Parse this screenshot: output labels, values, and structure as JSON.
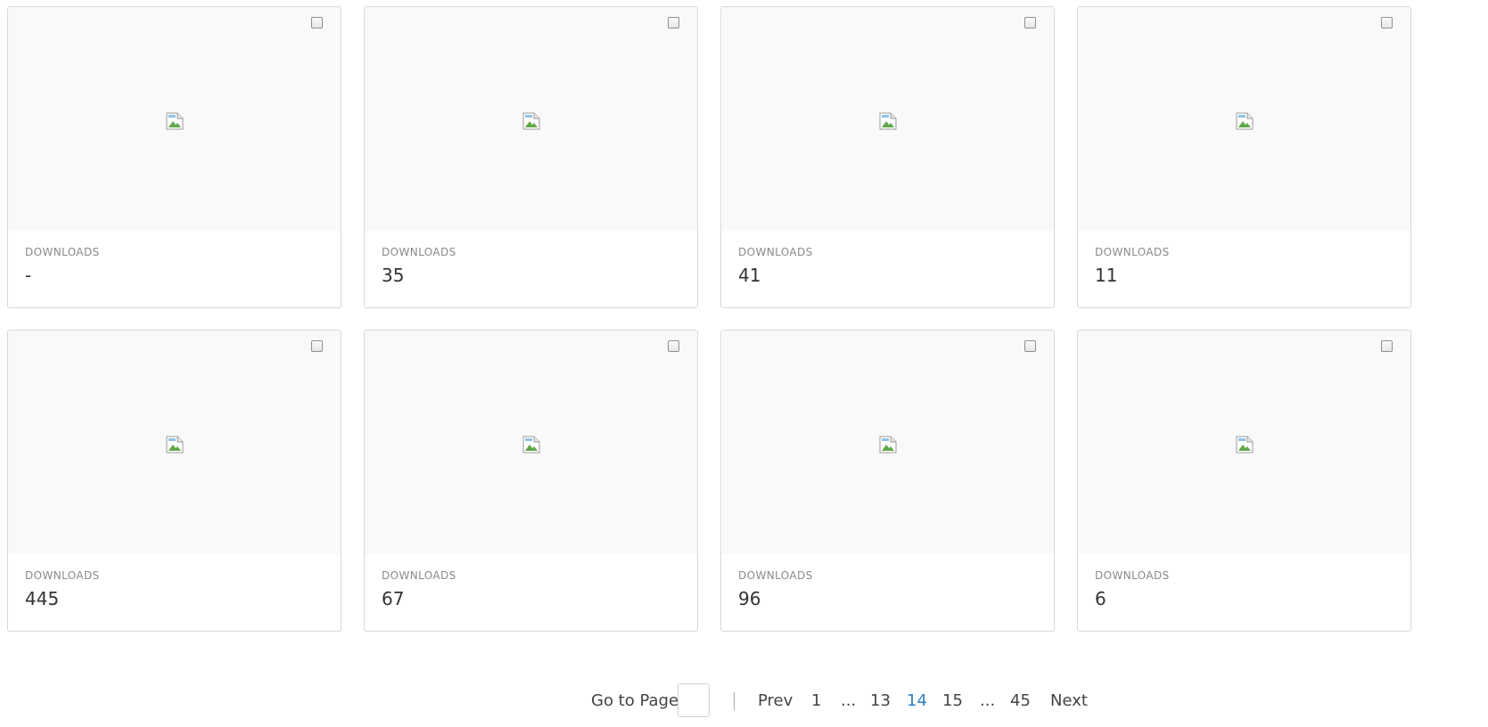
{
  "cards": [
    {
      "label": "DOWNLOADS",
      "value": "-"
    },
    {
      "label": "DOWNLOADS",
      "value": "35"
    },
    {
      "label": "DOWNLOADS",
      "value": "41"
    },
    {
      "label": "DOWNLOADS",
      "value": "11"
    },
    {
      "label": "DOWNLOADS",
      "value": "445"
    },
    {
      "label": "DOWNLOADS",
      "value": "67"
    },
    {
      "label": "DOWNLOADS",
      "value": "96"
    },
    {
      "label": "DOWNLOADS",
      "value": "6"
    }
  ],
  "pagination": {
    "goto_label": "Go to Page",
    "goto_value": "",
    "prev": "Prev",
    "first": "1",
    "ellipsis_left": "...",
    "page_prev": "13",
    "current": "14",
    "page_next": "15",
    "ellipsis_right": "...",
    "last": "45",
    "next": "Next"
  },
  "icons": {
    "card_image": "broken-image-icon",
    "select": "checkbox"
  },
  "colors": {
    "current_page": "#2d7fc3",
    "thumb_background": "#f9f9f9"
  }
}
